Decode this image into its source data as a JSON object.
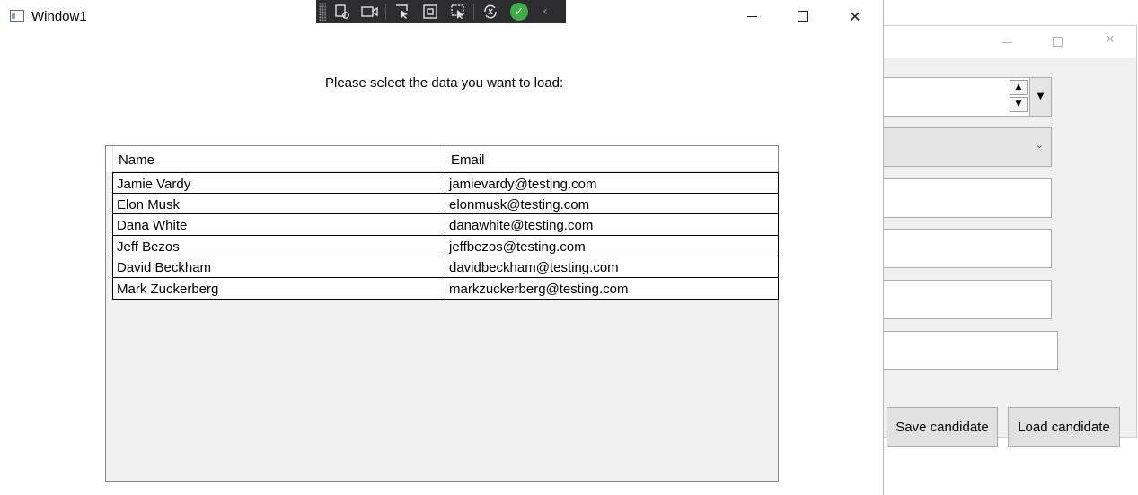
{
  "background_window": {
    "buttons": {
      "save_label": "Save candidate",
      "load_label": "Load candidate"
    }
  },
  "main_window": {
    "title": "Window1",
    "prompt": "Please select the data you want to load:",
    "debug_toolbar": {
      "icons": [
        "select-element-icon",
        "video-camera-icon",
        "pointer-select-icon",
        "display-layout-icon",
        "track-focus-icon",
        "hot-reload-icon",
        "checkmark-icon",
        "collapse-arrow-icon"
      ]
    },
    "grid": {
      "columns": [
        "Name",
        "Email"
      ],
      "rows": [
        {
          "name": "Jamie Vardy",
          "email": "jamievardy@testing.com"
        },
        {
          "name": "Elon Musk",
          "email": "elonmusk@testing.com"
        },
        {
          "name": "Dana White",
          "email": "danawhite@testing.com"
        },
        {
          "name": "Jeff Bezos",
          "email": "jeffbezos@testing.com"
        },
        {
          "name": "David Beckham",
          "email": "davidbeckham@testing.com"
        },
        {
          "name": "Mark Zuckerberg",
          "email": "markzuckerberg@testing.com"
        }
      ]
    }
  },
  "colors": {
    "window_background": "#ffffff",
    "grid_background": "#f0f0f0",
    "button_face": "#e1e1e1",
    "toolbar_background": "#2d2d30",
    "status_green": "#3fae49"
  }
}
